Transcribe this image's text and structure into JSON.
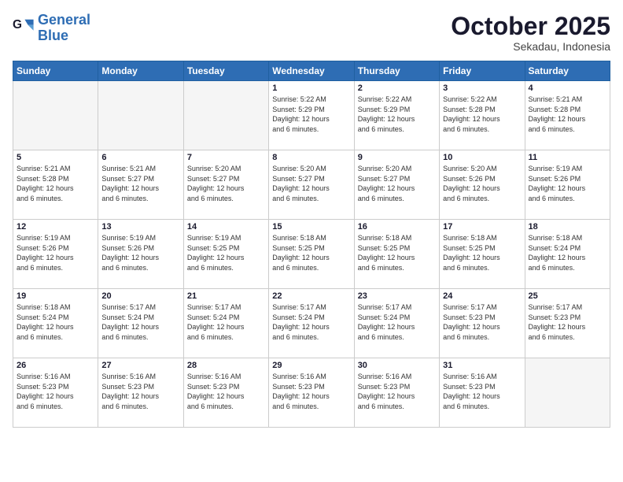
{
  "logo": {
    "line1": "General",
    "line2": "Blue"
  },
  "header": {
    "month": "October 2025",
    "location": "Sekadau, Indonesia"
  },
  "weekdays": [
    "Sunday",
    "Monday",
    "Tuesday",
    "Wednesday",
    "Thursday",
    "Friday",
    "Saturday"
  ],
  "weeks": [
    [
      {
        "day": "",
        "info": ""
      },
      {
        "day": "",
        "info": ""
      },
      {
        "day": "",
        "info": ""
      },
      {
        "day": "1",
        "info": "Sunrise: 5:22 AM\nSunset: 5:29 PM\nDaylight: 12 hours\nand 6 minutes."
      },
      {
        "day": "2",
        "info": "Sunrise: 5:22 AM\nSunset: 5:29 PM\nDaylight: 12 hours\nand 6 minutes."
      },
      {
        "day": "3",
        "info": "Sunrise: 5:22 AM\nSunset: 5:28 PM\nDaylight: 12 hours\nand 6 minutes."
      },
      {
        "day": "4",
        "info": "Sunrise: 5:21 AM\nSunset: 5:28 PM\nDaylight: 12 hours\nand 6 minutes."
      }
    ],
    [
      {
        "day": "5",
        "info": "Sunrise: 5:21 AM\nSunset: 5:28 PM\nDaylight: 12 hours\nand 6 minutes."
      },
      {
        "day": "6",
        "info": "Sunrise: 5:21 AM\nSunset: 5:27 PM\nDaylight: 12 hours\nand 6 minutes."
      },
      {
        "day": "7",
        "info": "Sunrise: 5:20 AM\nSunset: 5:27 PM\nDaylight: 12 hours\nand 6 minutes."
      },
      {
        "day": "8",
        "info": "Sunrise: 5:20 AM\nSunset: 5:27 PM\nDaylight: 12 hours\nand 6 minutes."
      },
      {
        "day": "9",
        "info": "Sunrise: 5:20 AM\nSunset: 5:27 PM\nDaylight: 12 hours\nand 6 minutes."
      },
      {
        "day": "10",
        "info": "Sunrise: 5:20 AM\nSunset: 5:26 PM\nDaylight: 12 hours\nand 6 minutes."
      },
      {
        "day": "11",
        "info": "Sunrise: 5:19 AM\nSunset: 5:26 PM\nDaylight: 12 hours\nand 6 minutes."
      }
    ],
    [
      {
        "day": "12",
        "info": "Sunrise: 5:19 AM\nSunset: 5:26 PM\nDaylight: 12 hours\nand 6 minutes."
      },
      {
        "day": "13",
        "info": "Sunrise: 5:19 AM\nSunset: 5:26 PM\nDaylight: 12 hours\nand 6 minutes."
      },
      {
        "day": "14",
        "info": "Sunrise: 5:19 AM\nSunset: 5:25 PM\nDaylight: 12 hours\nand 6 minutes."
      },
      {
        "day": "15",
        "info": "Sunrise: 5:18 AM\nSunset: 5:25 PM\nDaylight: 12 hours\nand 6 minutes."
      },
      {
        "day": "16",
        "info": "Sunrise: 5:18 AM\nSunset: 5:25 PM\nDaylight: 12 hours\nand 6 minutes."
      },
      {
        "day": "17",
        "info": "Sunrise: 5:18 AM\nSunset: 5:25 PM\nDaylight: 12 hours\nand 6 minutes."
      },
      {
        "day": "18",
        "info": "Sunrise: 5:18 AM\nSunset: 5:24 PM\nDaylight: 12 hours\nand 6 minutes."
      }
    ],
    [
      {
        "day": "19",
        "info": "Sunrise: 5:18 AM\nSunset: 5:24 PM\nDaylight: 12 hours\nand 6 minutes."
      },
      {
        "day": "20",
        "info": "Sunrise: 5:17 AM\nSunset: 5:24 PM\nDaylight: 12 hours\nand 6 minutes."
      },
      {
        "day": "21",
        "info": "Sunrise: 5:17 AM\nSunset: 5:24 PM\nDaylight: 12 hours\nand 6 minutes."
      },
      {
        "day": "22",
        "info": "Sunrise: 5:17 AM\nSunset: 5:24 PM\nDaylight: 12 hours\nand 6 minutes."
      },
      {
        "day": "23",
        "info": "Sunrise: 5:17 AM\nSunset: 5:24 PM\nDaylight: 12 hours\nand 6 minutes."
      },
      {
        "day": "24",
        "info": "Sunrise: 5:17 AM\nSunset: 5:23 PM\nDaylight: 12 hours\nand 6 minutes."
      },
      {
        "day": "25",
        "info": "Sunrise: 5:17 AM\nSunset: 5:23 PM\nDaylight: 12 hours\nand 6 minutes."
      }
    ],
    [
      {
        "day": "26",
        "info": "Sunrise: 5:16 AM\nSunset: 5:23 PM\nDaylight: 12 hours\nand 6 minutes."
      },
      {
        "day": "27",
        "info": "Sunrise: 5:16 AM\nSunset: 5:23 PM\nDaylight: 12 hours\nand 6 minutes."
      },
      {
        "day": "28",
        "info": "Sunrise: 5:16 AM\nSunset: 5:23 PM\nDaylight: 12 hours\nand 6 minutes."
      },
      {
        "day": "29",
        "info": "Sunrise: 5:16 AM\nSunset: 5:23 PM\nDaylight: 12 hours\nand 6 minutes."
      },
      {
        "day": "30",
        "info": "Sunrise: 5:16 AM\nSunset: 5:23 PM\nDaylight: 12 hours\nand 6 minutes."
      },
      {
        "day": "31",
        "info": "Sunrise: 5:16 AM\nSunset: 5:23 PM\nDaylight: 12 hours\nand 6 minutes."
      },
      {
        "day": "",
        "info": ""
      }
    ]
  ]
}
